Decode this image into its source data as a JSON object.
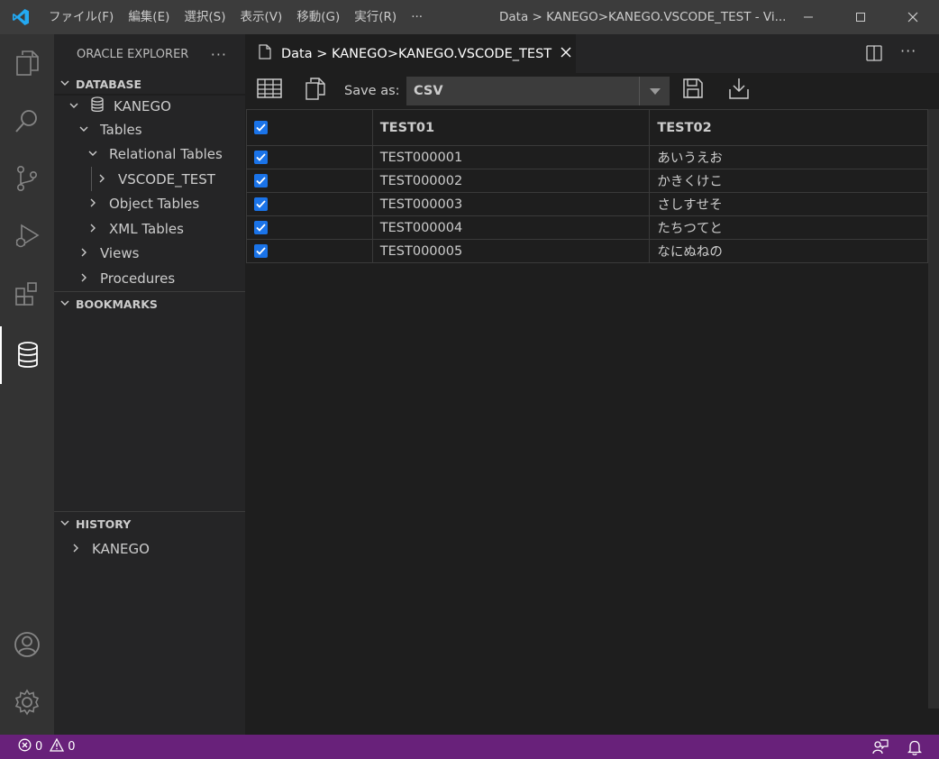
{
  "menu": [
    "ファイル(F)",
    "編集(E)",
    "選択(S)",
    "表示(V)",
    "移動(G)",
    "実行(R)",
    "···"
  ],
  "window_title": "Data > KANEGO>KANEGO.VSCODE_TEST - Vi...",
  "sidebar": {
    "title": "ORACLE EXPLORER",
    "more": "···",
    "database_label": "DATABASE",
    "tree": {
      "connection": "KANEGO",
      "tables": "Tables",
      "relational_tables": "Relational Tables",
      "vscode_test": "VSCODE_TEST",
      "object_tables": "Object Tables",
      "xml_tables": "XML Tables",
      "views": "Views",
      "procedures": "Procedures"
    },
    "bookmarks_label": "BOOKMARKS",
    "history_label": "HISTORY",
    "history_item": "KANEGO"
  },
  "tab": {
    "label": "Data > KANEGO>KANEGO.VSCODE_TEST"
  },
  "editor_actions_more": "···",
  "toolbar": {
    "save_as_label": "Save as:",
    "format_value": "CSV"
  },
  "grid": {
    "columns": [
      "TEST01",
      "TEST02"
    ],
    "rows": [
      {
        "checked": true,
        "test01": "TEST000001",
        "test02": "あいうえお"
      },
      {
        "checked": true,
        "test01": "TEST000002",
        "test02": "かきくけこ"
      },
      {
        "checked": true,
        "test01": "TEST000003",
        "test02": "さしすせそ"
      },
      {
        "checked": true,
        "test01": "TEST000004",
        "test02": "たちつてと"
      },
      {
        "checked": true,
        "test01": "TEST000005",
        "test02": "なにぬねの"
      }
    ]
  },
  "status": {
    "errors": "0",
    "warnings": "0"
  },
  "colors": {
    "statusbar": "#68217a",
    "checkbox": "#1a73e8",
    "vscode_blue": "#23a9f2"
  }
}
